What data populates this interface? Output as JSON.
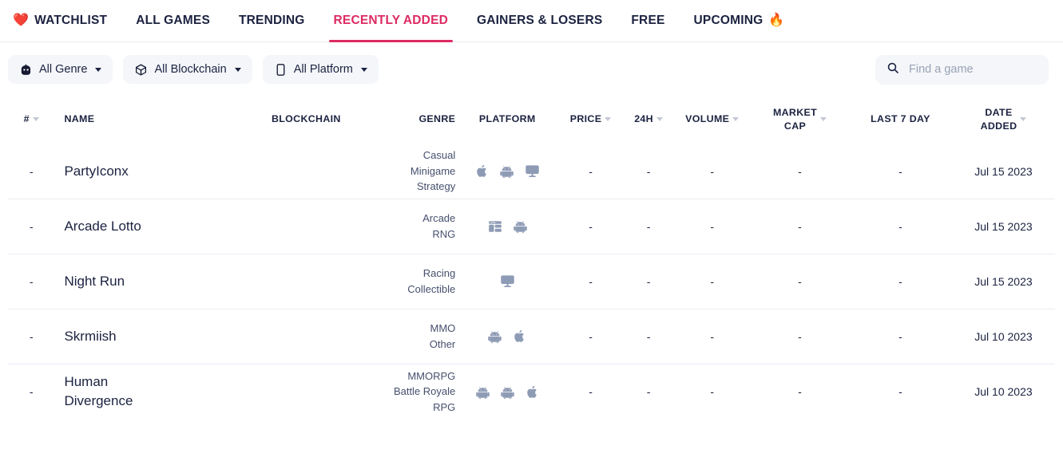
{
  "nav": {
    "items": [
      {
        "label": "WATCHLIST",
        "icon": "heart-icon",
        "emoji": "❤️",
        "active": false
      },
      {
        "label": "ALL GAMES",
        "active": false
      },
      {
        "label": "TRENDING",
        "active": false
      },
      {
        "label": "RECENTLY ADDED",
        "active": true
      },
      {
        "label": "GAINERS & LOSERS",
        "active": false
      },
      {
        "label": "FREE",
        "active": false
      },
      {
        "label": "UPCOMING",
        "icon": "fire-icon",
        "emoji": "🔥",
        "active": false
      }
    ],
    "active_color": "#dc2a62"
  },
  "filters": {
    "genre": {
      "label": "All Genre",
      "icon": "gamepad-icon"
    },
    "blockchain": {
      "label": "All Blockchain",
      "icon": "cube-icon"
    },
    "platform": {
      "label": "All Platform",
      "icon": "mobile-icon"
    }
  },
  "search": {
    "placeholder": "Find a game",
    "value": "",
    "icon": "search-icon"
  },
  "table": {
    "columns": [
      {
        "key": "rank",
        "label": "#",
        "sortable": true,
        "align": "center"
      },
      {
        "key": "name",
        "label": "NAME",
        "sortable": false,
        "align": "left"
      },
      {
        "key": "blockchain",
        "label": "BLOCKCHAIN",
        "sortable": false,
        "align": "center"
      },
      {
        "key": "genre",
        "label": "GENRE",
        "sortable": false,
        "align": "right"
      },
      {
        "key": "platform",
        "label": "PLATFORM",
        "sortable": false,
        "align": "center"
      },
      {
        "key": "price",
        "label": "PRICE",
        "sortable": true,
        "align": "right"
      },
      {
        "key": "h24",
        "label": "24H",
        "sortable": true,
        "align": "right"
      },
      {
        "key": "volume",
        "label": "VOLUME",
        "sortable": true,
        "align": "right"
      },
      {
        "key": "market_cap",
        "label": "MARKET CAP",
        "sortable": true,
        "align": "center"
      },
      {
        "key": "last7day",
        "label": "LAST 7 DAY",
        "sortable": false,
        "align": "right"
      },
      {
        "key": "date_added",
        "label": "DATE ADDED",
        "sortable": true,
        "align": "center"
      }
    ],
    "rows": [
      {
        "rank": "-",
        "name": "PartyIconx",
        "blockchain": "",
        "genres": [
          "Casual",
          "Minigame",
          "Strategy"
        ],
        "platforms": [
          "apple-icon",
          "android-icon",
          "desktop-icon"
        ],
        "price": "-",
        "h24": "-",
        "volume": "-",
        "market_cap": "-",
        "last7day": "-",
        "date_added": "Jul 15 2023"
      },
      {
        "rank": "-",
        "name": "Arcade Lotto",
        "blockchain": "",
        "genres": [
          "Arcade",
          "RNG"
        ],
        "platforms": [
          "browser-icon",
          "android-icon"
        ],
        "price": "-",
        "h24": "-",
        "volume": "-",
        "market_cap": "-",
        "last7day": "-",
        "date_added": "Jul 15 2023"
      },
      {
        "rank": "-",
        "name": "Night Run",
        "blockchain": "",
        "genres": [
          "Racing",
          "Collectible"
        ],
        "platforms": [
          "desktop-icon"
        ],
        "price": "-",
        "h24": "-",
        "volume": "-",
        "market_cap": "-",
        "last7day": "-",
        "date_added": "Jul 15 2023"
      },
      {
        "rank": "-",
        "name": "Skrmiish",
        "blockchain": "",
        "genres": [
          "MMO",
          "Other"
        ],
        "platforms": [
          "android-icon",
          "apple-icon"
        ],
        "price": "-",
        "h24": "-",
        "volume": "-",
        "market_cap": "-",
        "last7day": "-",
        "date_added": "Jul 10 2023"
      },
      {
        "rank": "-",
        "name": "Human Divergence",
        "blockchain": "",
        "genres": [
          "MMORPG",
          "Battle Royale",
          "RPG"
        ],
        "platforms": [
          "android-icon",
          "android-icon",
          "apple-icon"
        ],
        "price": "-",
        "h24": "-",
        "volume": "-",
        "market_cap": "-",
        "last7day": "-",
        "date_added": "Jul 10 2023"
      }
    ]
  }
}
